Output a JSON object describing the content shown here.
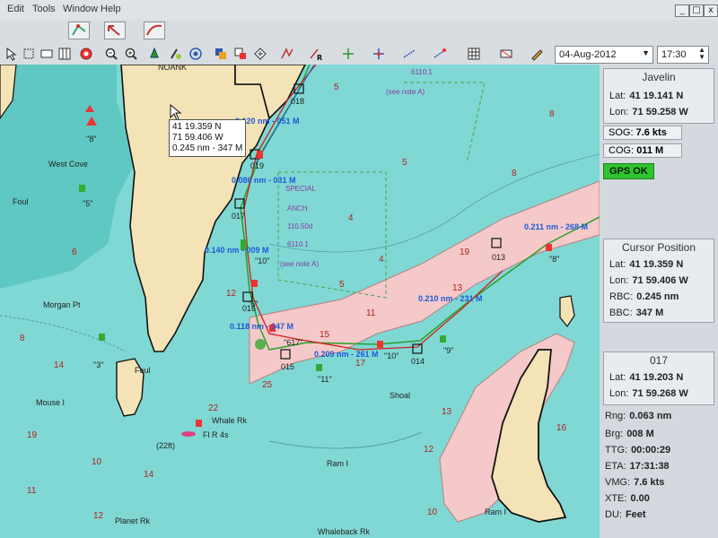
{
  "menu": {
    "items": [
      "Edit",
      "Tools",
      "Window",
      "Help"
    ]
  },
  "window_controls": [
    "_",
    "□",
    "x"
  ],
  "toolbar": {
    "date": "04-Aug-2012",
    "time": "17:30"
  },
  "icons": [
    "chart-icon",
    "route-icon",
    "track-icon",
    "cursor-icon",
    "zoom-out-icon",
    "zoom-in-icon",
    "boat-icon",
    "pan-icon",
    "target-icon",
    "layers-icon",
    "waypoint-icon",
    "vector-icon",
    "route-r-icon",
    "crosshair-icon",
    "grid-icon"
  ],
  "tooltip": {
    "lat": "41 19.359 N",
    "lon": "71 59.406 W",
    "range_bearing": "0.245 nm - 347 M"
  },
  "panel": {
    "vessel": {
      "title": "Javelin",
      "lat_label": "Lat:",
      "lat": "41 19.141 N",
      "lon_label": "Lon:",
      "lon": "71 59.258 W"
    },
    "sog": {
      "label": "SOG:",
      "value": "7.6 kts"
    },
    "cog": {
      "label": "COG:",
      "value": "011 M"
    },
    "gps_status": "GPS OK",
    "cursor": {
      "title": "Cursor Position",
      "lat_label": "Lat:",
      "lat": "41 19.359 N",
      "lon_label": "Lon:",
      "lon": "71 59.406 W",
      "rbc_label": "RBC:",
      "rbc": "0.245 nm",
      "bbc_label": "BBC:",
      "bbc": "347 M"
    },
    "waypoint": {
      "title": "017",
      "lat_label": "Lat:",
      "lat": "41 19.203 N",
      "lon_label": "Lon:",
      "lon": "71 59.268 W",
      "rng_label": "Rng:",
      "rng": "0.063 nm",
      "brg_label": "Brg:",
      "brg": "008 M",
      "ttg_label": "TTG:",
      "ttg": "00:00:29",
      "eta_label": "ETA:",
      "eta": "17:31:38",
      "vmg_label": "VMG:",
      "vmg": "7.6 kts",
      "xte_label": "XTE:",
      "xte": "0.00",
      "du_label": "DU:",
      "du": "Feet"
    }
  },
  "map": {
    "route_legs": [
      "0.120 nm - 051 M",
      "0.086 nm - 031 M",
      "0.140 nm - 009 M",
      "0.118 nm - 347 M",
      "0.209 nm - 261 M",
      "0.210 nm - 231 M",
      "0.211 nm - 268 M"
    ],
    "waypoints": [
      "018",
      "019",
      "017",
      "016",
      "015",
      "014",
      "013"
    ],
    "place_names": [
      "West Cove",
      "Foul",
      "Morgan Pt",
      "Mouse I",
      "Whale Rk",
      "Ram I",
      "Planet Rk",
      "Whaleback Rk",
      "Shoal",
      "Foul"
    ],
    "buoys": [
      "\"8\"",
      "\"10\"",
      "\"5\"",
      "\"3\"",
      "\"11\"",
      "\"9\"",
      "\"617\"",
      "\"10\"",
      "\"8\"",
      "\"6\""
    ],
    "notes": [
      "SPECIAL",
      "ANCH",
      "110.50d",
      "6110.1",
      "(see note A)",
      "(see note A)",
      "6110.1"
    ],
    "light": "Fl R 4s",
    "depth_ft": "(22ft)",
    "coast_label": "NOANK"
  }
}
